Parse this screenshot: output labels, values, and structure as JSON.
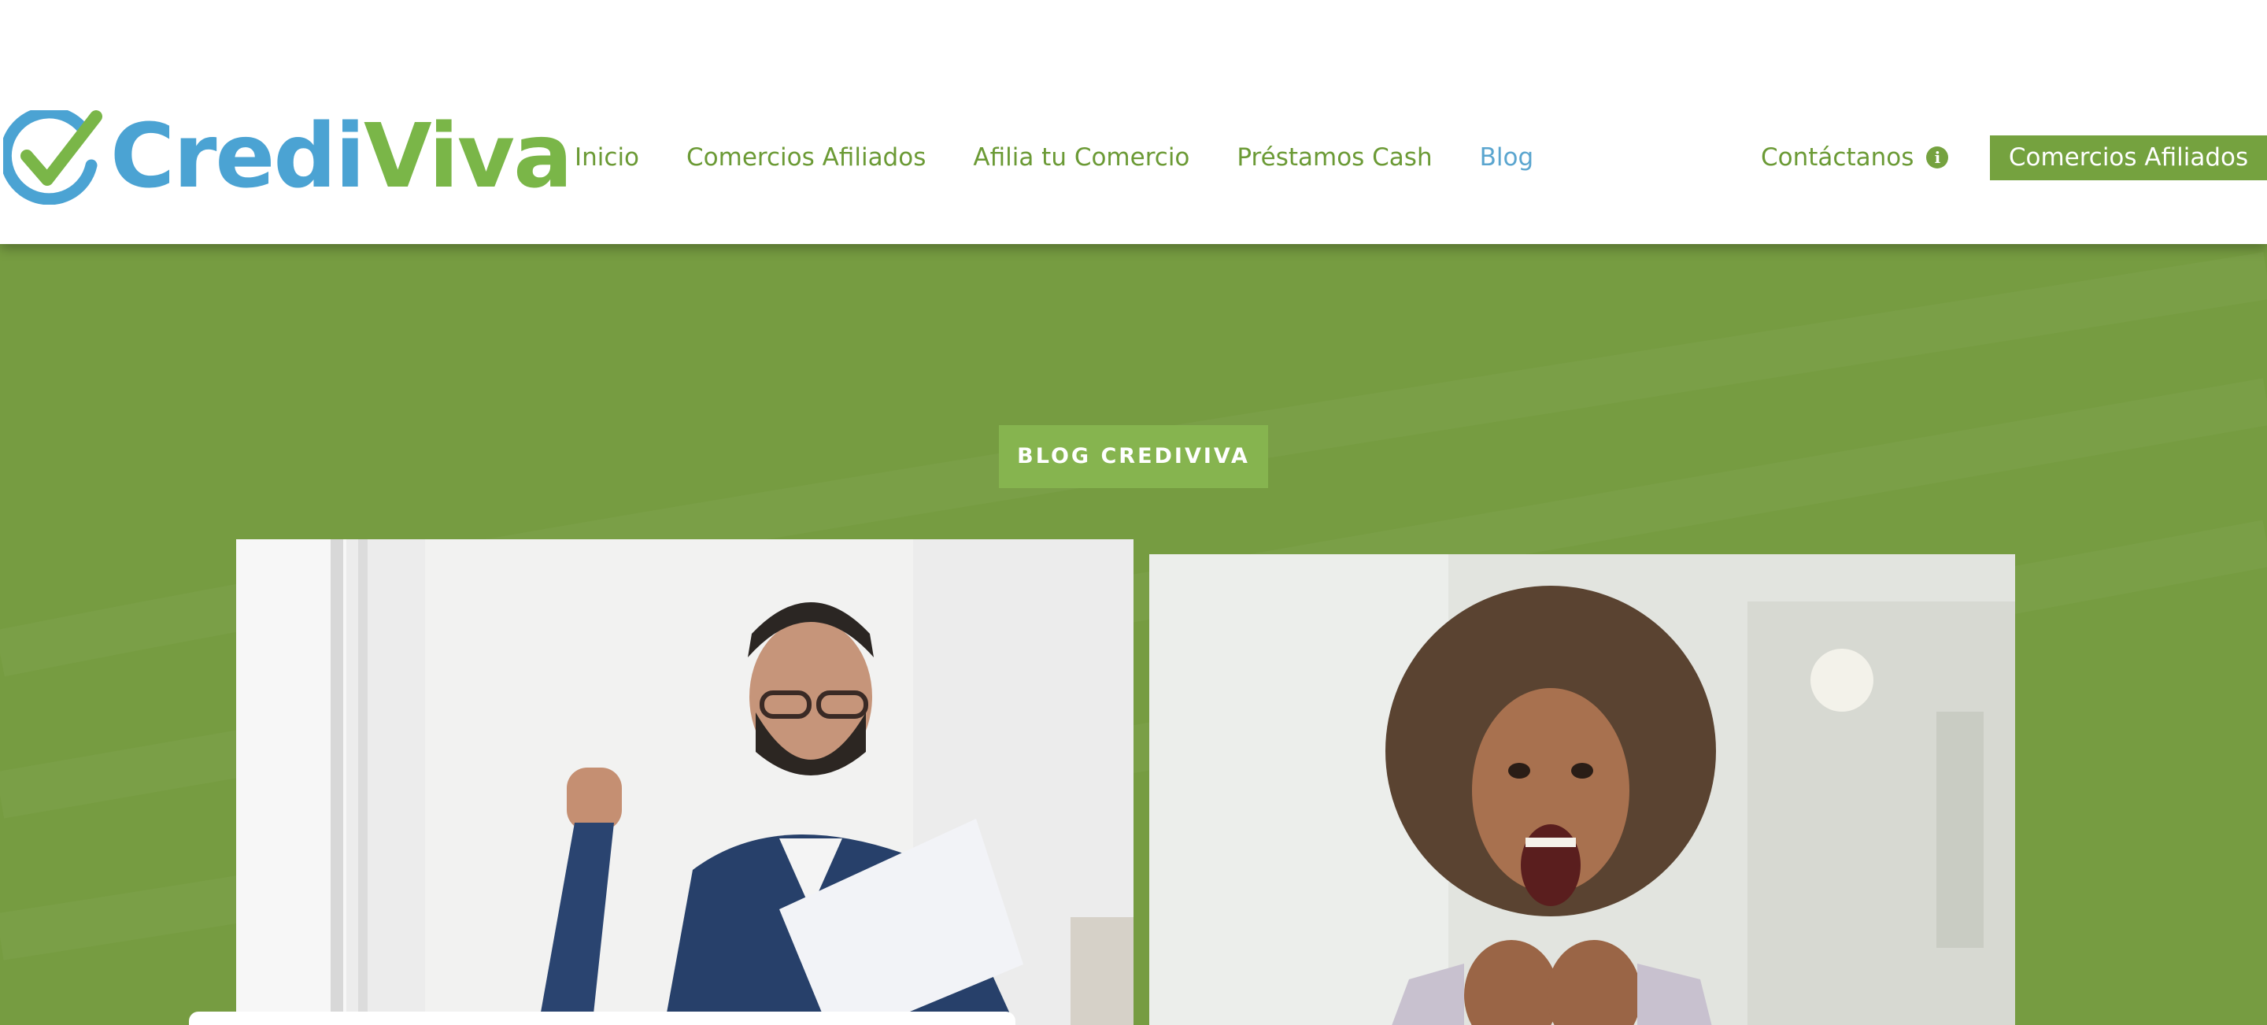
{
  "brand": {
    "name_part1": "Credi",
    "name_part2": "Viva",
    "colors": {
      "blue": "#4ba3d3",
      "green": "#7ab648",
      "dark_green": "#75a23f",
      "nav_green": "#6b9a35",
      "hero_green": "#769c41",
      "badge_green": "#86b44f",
      "active_blue": "#5aa5cf"
    }
  },
  "nav": {
    "items": [
      {
        "label": "Inicio",
        "active": false
      },
      {
        "label": "Comercios Afiliados",
        "active": false
      },
      {
        "label": "Afilia tu Comercio",
        "active": false
      },
      {
        "label": "Préstamos Cash",
        "active": false
      },
      {
        "label": "Blog",
        "active": true
      }
    ],
    "contact_label": "Contáctanos",
    "contact_icon": "info-icon",
    "cta_label": "Comercios Afiliados"
  },
  "hero": {
    "badge_label": "BLOG CREDIVIVA"
  }
}
